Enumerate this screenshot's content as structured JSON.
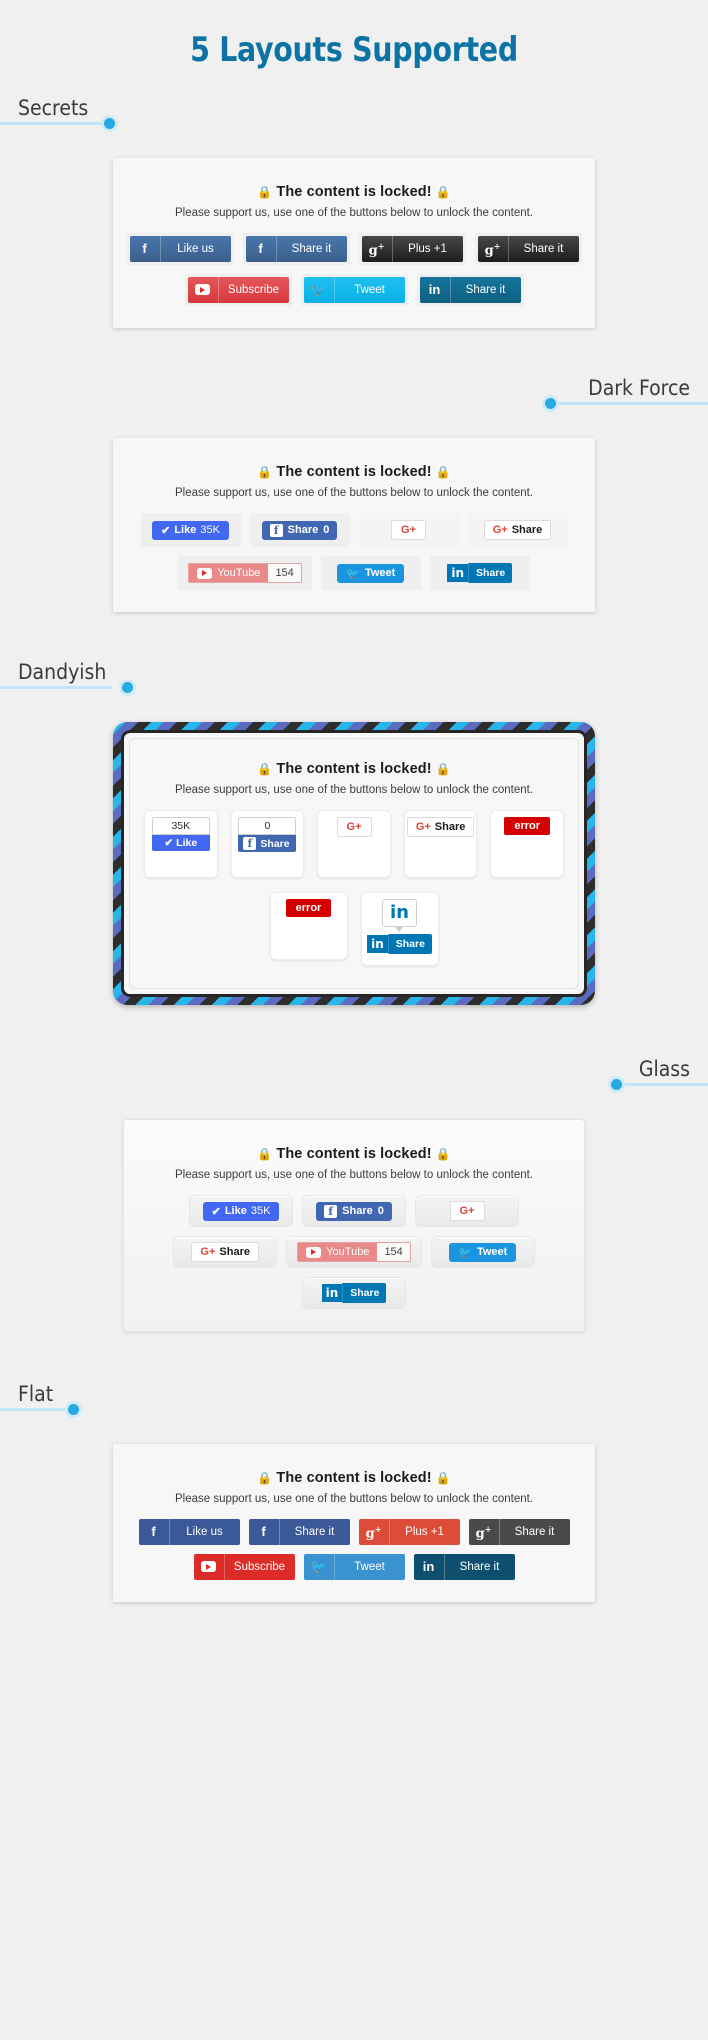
{
  "page": {
    "title": "5 Layouts Supported",
    "accent": "#0d73a4",
    "bg": "#eff0ef"
  },
  "locked": {
    "heading": "The content is locked!",
    "lock_icon": "lock-icon",
    "subtext": "Please support us, use one of the buttons below to unlock the content."
  },
  "sections": [
    {
      "label": "Secrets"
    },
    {
      "label": "Dark Force"
    },
    {
      "label": "Dandyish"
    },
    {
      "label": "Glass"
    },
    {
      "label": "Flat"
    }
  ],
  "secrets": {
    "row1": [
      {
        "icon": "facebook-icon",
        "glyph": "f",
        "label": "Like us",
        "color": "#3b5f8c"
      },
      {
        "icon": "facebook-icon",
        "glyph": "f",
        "label": "Share it",
        "color": "#3b5f8c"
      },
      {
        "icon": "google-plus-icon",
        "glyph": "g+",
        "label": "Plus +1",
        "color": "#1d1d1d"
      },
      {
        "icon": "google-plus-icon",
        "glyph": "g+",
        "label": "Share it",
        "color": "#1d1d1d"
      }
    ],
    "row2": [
      {
        "icon": "youtube-icon",
        "glyph": "▶",
        "label": "Subscribe",
        "color": "#d8383d"
      },
      {
        "icon": "twitter-icon",
        "glyph": "🐦",
        "label": "Tweet",
        "color": "#09b0e5"
      },
      {
        "icon": "linkedin-icon",
        "glyph": "in",
        "label": "Share it",
        "color": "#0d5f80"
      }
    ]
  },
  "darkforce": {
    "row1": [
      {
        "widget": "facebook-like",
        "check": "✔",
        "label": "Like",
        "count": "35K"
      },
      {
        "widget": "facebook-share",
        "icon": "facebook-icon",
        "label": "Share",
        "count": "0"
      },
      {
        "widget": "google-plus-one",
        "label": "G",
        "plus": "+"
      },
      {
        "widget": "google-plus-share",
        "icon": "google-plus-icon",
        "label": "Share"
      }
    ],
    "row2": [
      {
        "widget": "youtube-subscribe",
        "icon": "youtube-icon",
        "label": "YouTube",
        "count": "154"
      },
      {
        "widget": "twitter-tweet",
        "icon": "twitter-icon",
        "label": "Tweet"
      },
      {
        "widget": "linkedin-share",
        "icon": "linkedin-icon",
        "label": "Share"
      }
    ]
  },
  "dandyish": {
    "row1": [
      {
        "widget": "facebook-like-vertical",
        "count": "35K",
        "check": "✔",
        "label": "Like"
      },
      {
        "widget": "facebook-share-vertical",
        "count": "0",
        "icon": "facebook-icon",
        "label": "Share"
      },
      {
        "widget": "google-plus-one",
        "label": "G",
        "plus": "+"
      },
      {
        "widget": "google-plus-share",
        "icon": "google-plus-icon",
        "label": "Share"
      },
      {
        "widget": "youtube-error",
        "label": "error"
      }
    ],
    "row2": [
      {
        "widget": "twitter-error",
        "label": "error"
      },
      {
        "widget": "linkedin-share-vertical",
        "icon": "linkedin-icon",
        "label": "Share"
      }
    ]
  },
  "glass": {
    "row1": [
      {
        "widget": "facebook-like",
        "check": "✔",
        "label": "Like",
        "count": "35K"
      },
      {
        "widget": "facebook-share",
        "icon": "facebook-icon",
        "label": "Share",
        "count": "0"
      },
      {
        "widget": "google-plus-one",
        "label": "G",
        "plus": "+"
      }
    ],
    "row2": [
      {
        "widget": "google-plus-share",
        "icon": "google-plus-icon",
        "label": "Share"
      },
      {
        "widget": "youtube-subscribe",
        "icon": "youtube-icon",
        "label": "YouTube",
        "count": "154"
      },
      {
        "widget": "twitter-tweet",
        "icon": "twitter-icon",
        "label": "Tweet"
      }
    ],
    "row3": [
      {
        "widget": "linkedin-share",
        "icon": "linkedin-icon",
        "label": "Share"
      }
    ]
  },
  "flat": {
    "row1": [
      {
        "icon": "facebook-icon",
        "glyph": "f",
        "label": "Like us",
        "color": "#3b5998"
      },
      {
        "icon": "facebook-icon",
        "glyph": "f",
        "label": "Share it",
        "color": "#3b5998"
      },
      {
        "icon": "google-plus-icon",
        "glyph": "g+",
        "label": "Plus +1",
        "color": "#dd4b39"
      },
      {
        "icon": "google-plus-icon",
        "glyph": "g+",
        "label": "Share it",
        "color": "#4a4a4a"
      }
    ],
    "row2": [
      {
        "icon": "youtube-icon",
        "glyph": "▶",
        "label": "Subscribe",
        "color": "#dd2c28"
      },
      {
        "icon": "twitter-icon",
        "glyph": "🐦",
        "label": "Tweet",
        "color": "#3b92d1"
      },
      {
        "icon": "linkedin-icon",
        "glyph": "in",
        "label": "Share it",
        "color": "#0e4f70"
      }
    ]
  }
}
